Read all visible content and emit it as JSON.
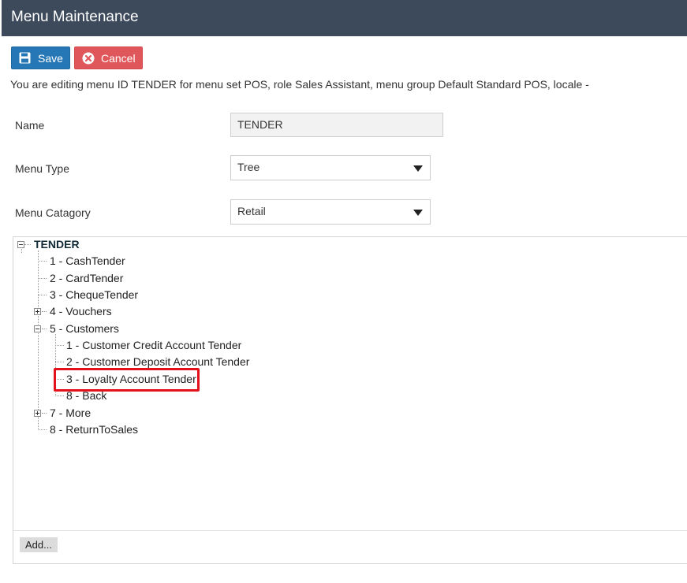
{
  "header": {
    "title": "Menu Maintenance"
  },
  "toolbar": {
    "save_label": "Save",
    "cancel_label": "Cancel",
    "save_icon": "floppy-disk-icon",
    "cancel_icon": "circle-x-icon"
  },
  "info_text": "You are editing menu ID TENDER for menu set POS, role Sales Assistant, menu group Default Standard POS, locale -",
  "form": {
    "name_label": "Name",
    "name_value": "TENDER",
    "menu_type_label": "Menu Type",
    "menu_type_value": "Tree",
    "menu_category_label": "Menu Catagory",
    "menu_category_value": "Retail"
  },
  "tree": {
    "root": "TENDER",
    "items": [
      "1 - CashTender",
      "2 - CardTender",
      "3 - ChequeTender",
      "4 - Vouchers",
      "5 - Customers",
      "7 - More",
      "8 - ReturnToSales"
    ],
    "customers_children": [
      "1 - Customer Credit Account Tender",
      "2 - Customer Deposit Account Tender",
      "3 - Loyalty Account Tender",
      "8 - Back"
    ],
    "add_label": "Add..."
  },
  "colors": {
    "header_bg": "#3d4a5c",
    "save_bg": "#2577b5",
    "cancel_bg": "#e0575b",
    "highlight": "#e3111a"
  }
}
